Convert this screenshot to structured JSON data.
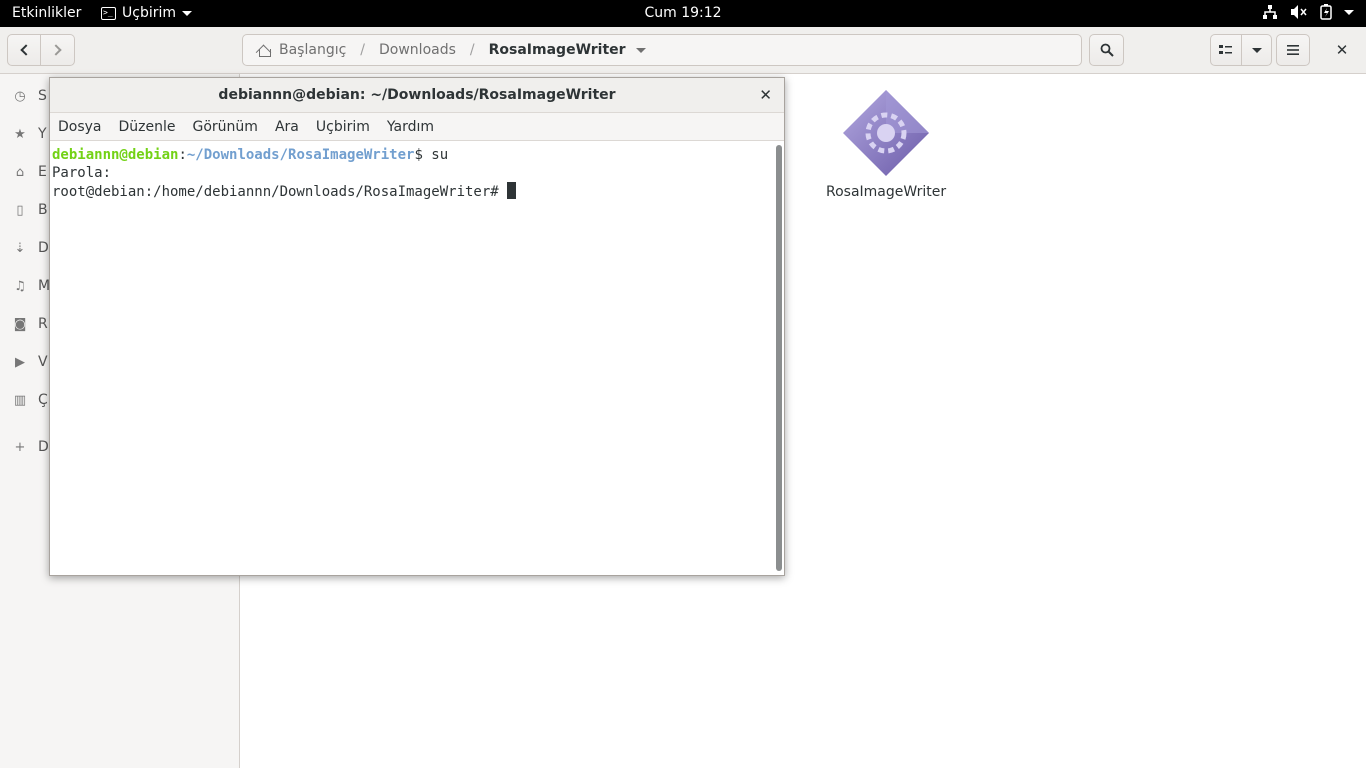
{
  "topbar": {
    "activities": "Etkinlikler",
    "app_name": "Uçbirim",
    "clock": "Cum 19:12",
    "status_icons": [
      "network-icon",
      "volume-muted-icon",
      "battery-charging-icon",
      "system-menu-arrow-icon"
    ]
  },
  "files": {
    "path": {
      "home": "Başlangıç",
      "segment_1": "Downloads",
      "current": "RosaImageWriter"
    },
    "sidebar": [
      {
        "label": "S",
        "icon": "recent-icon"
      },
      {
        "label": "Y",
        "icon": "starred-icon"
      },
      {
        "label": "E",
        "icon": "home-icon"
      },
      {
        "label": "B",
        "icon": "documents-icon"
      },
      {
        "label": "D",
        "icon": "downloads-icon"
      },
      {
        "label": "M",
        "icon": "music-icon"
      },
      {
        "label": "R",
        "icon": "pictures-icon"
      },
      {
        "label": "V",
        "icon": "videos-icon"
      },
      {
        "label": "Ç",
        "icon": "trash-icon"
      },
      {
        "label": "D",
        "icon": "other-locations-icon"
      }
    ],
    "items": [
      {
        "name": "RosaImageWriter",
        "icon": "executable-icon"
      }
    ]
  },
  "terminal": {
    "title": "debiannn@debian: ~/Downloads/RosaImageWriter",
    "menu": [
      "Dosya",
      "Düzenle",
      "Görünüm",
      "Ara",
      "Uçbirim",
      "Yardım"
    ],
    "lines": {
      "user_host": "debiannn@debian",
      "colon": ":",
      "path": "~/Downloads/RosaImageWriter",
      "command": "$ su",
      "line2": "Parola:",
      "line3": "root@debian:/home/debiannn/Downloads/RosaImageWriter# "
    }
  },
  "colors": {
    "prompt_user": "#73d216",
    "prompt_path": "#729fcf",
    "topbar_bg": "#000000",
    "icon_purple": "#8b7fc4"
  }
}
